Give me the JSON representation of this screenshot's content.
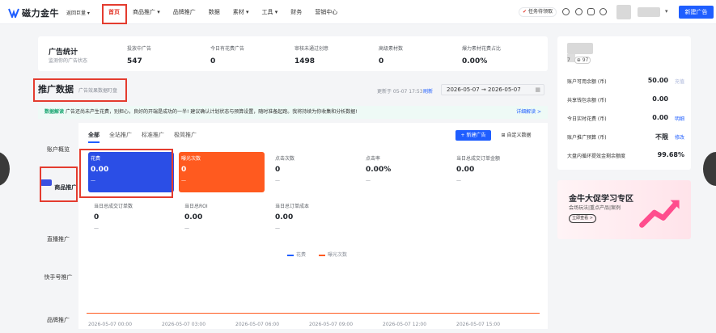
{
  "header": {
    "logo_text": "磁力金牛",
    "back_label": "返回巨量",
    "nav": [
      "首页",
      "商品推广",
      "品牌推广",
      "数据",
      "素材",
      "工具",
      "财务",
      "营销中心"
    ],
    "task_label": "任务待领取",
    "new_ad_label": "新建广告",
    "accent": "#e43c2f",
    "brand_blue": "#1f5eff"
  },
  "stats": {
    "title": "广告统计",
    "subtitle": "监测你的广告状态",
    "items": [
      {
        "label": "投放中广告",
        "value": "547"
      },
      {
        "label": "今日有花费广告",
        "value": "0"
      },
      {
        "label": "审核未通过创意",
        "value": "1498"
      },
      {
        "label": "高级素材数",
        "value": "0"
      },
      {
        "label": "爆力素材花费占比",
        "value": "0.00%"
      }
    ]
  },
  "promo": {
    "title": "推广数据",
    "subtitle": "广告效果数据盯盘",
    "update_text": "更新于 05-07 17:53",
    "refresh_label": "刷新",
    "date_start": "2026-05-07",
    "date_sep": "→",
    "date_end": "2026-05-07"
  },
  "notice": {
    "tag": "数据解读",
    "text": "广告还尚未产生花费，别担心，良好的开端是成功的一半! 建议确认计划状态与预算设置，随时准备起跑。我将持续为你收集和分析数据!",
    "link": "详细解读 >"
  },
  "submenu": [
    "账户概览",
    "商品推广",
    "直播推广",
    "快手号推广",
    "品牌推广"
  ],
  "tabs": [
    "全部",
    "全站推广",
    "标准推广",
    "极简推广"
  ],
  "new_btn": "+ 新建广告",
  "custom_btn": "自定义数据",
  "metrics": [
    {
      "label": "花费",
      "value": "0.00",
      "sub": "—"
    },
    {
      "label": "曝光次数",
      "value": "0",
      "sub": "—"
    },
    {
      "label": "点击次数",
      "value": "0",
      "sub": "—"
    },
    {
      "label": "点击率",
      "value": "0.00%",
      "sub": "—"
    },
    {
      "label": "当日总成交订单金额",
      "value": "0.00",
      "sub": "—"
    },
    {
      "label": "当日总成交订单数",
      "value": "0",
      "sub": "—"
    },
    {
      "label": "当日总ROI",
      "value": "0.00",
      "sub": "—"
    },
    {
      "label": "当日总订单成本",
      "value": "0.00",
      "sub": "—"
    }
  ],
  "chart_data": {
    "type": "line",
    "series": [
      {
        "name": "花费",
        "color": "#1f5eff",
        "values": [
          0,
          0,
          0,
          0,
          0,
          0
        ]
      },
      {
        "name": "曝光次数",
        "color": "#ff5a1f",
        "values": [
          0,
          0,
          0,
          0,
          0,
          0
        ]
      }
    ],
    "x": [
      "2026-05-07 00:00",
      "2026-05-07 03:00",
      "2026-05-07 06:00",
      "2026-05-07 09:00",
      "2026-05-07 12:00",
      "2026-05-07 15:00"
    ]
  },
  "account": {
    "id_text": "7",
    "badge": "97",
    "rows": [
      {
        "label": "账户可用余额 (币)",
        "value": "50.00",
        "link": "充值",
        "muted": true
      },
      {
        "label": "共享钱包余额 (币)",
        "value": "0.00",
        "link": "",
        "muted": false
      },
      {
        "label": "今日实时花费 (币)",
        "value": "0.00",
        "link": "明细",
        "muted": false
      },
      {
        "label": "账户推广预算 (币)",
        "value": "不限",
        "link": "修改",
        "muted": false
      },
      {
        "label": "大盘内循环提效金剩余额度",
        "value": "99.68%",
        "link": "",
        "muted": false
      }
    ]
  },
  "banner": {
    "title": "金牛大促学习专区",
    "subtitle": "会场玩法|重点产品|案例",
    "button": "立即查看 >"
  }
}
